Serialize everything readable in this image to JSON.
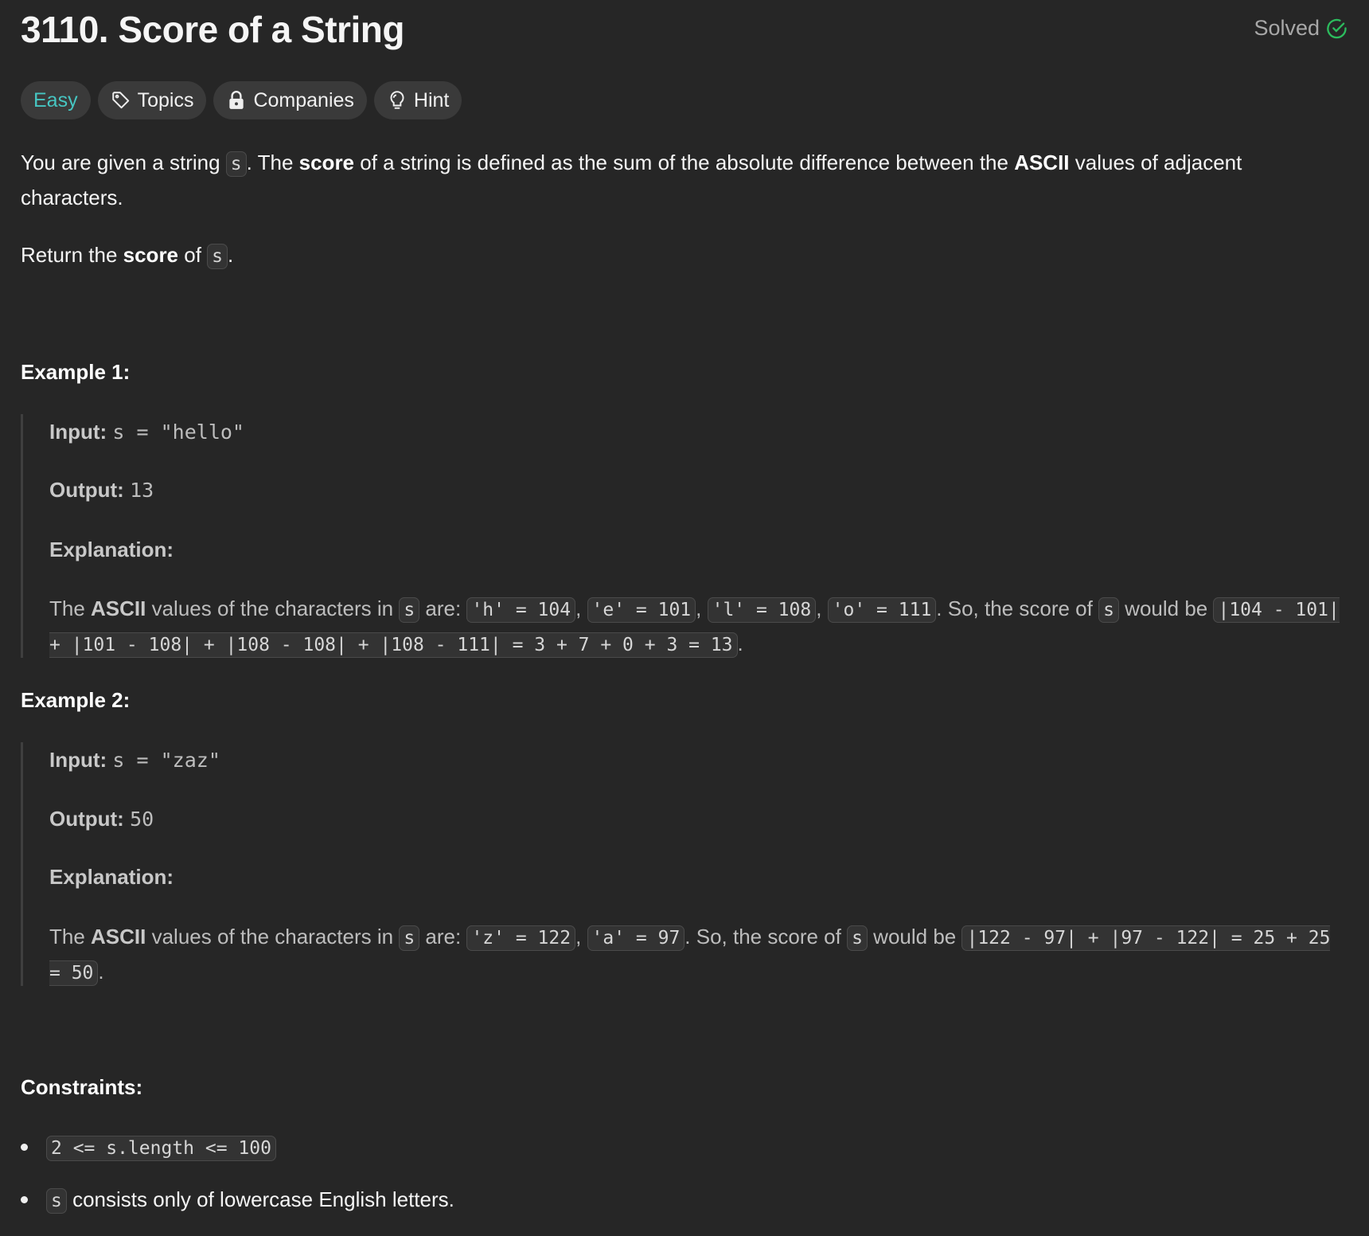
{
  "header": {
    "title": "3110. Score of a String",
    "status": "Solved",
    "status_color": "#2cbb5d"
  },
  "tags": {
    "difficulty": "Easy",
    "difficulty_color": "#46c6c2",
    "topics": "Topics",
    "companies": "Companies",
    "hint": "Hint"
  },
  "paragraphs": {
    "desc": [
      {
        "t": "You are given a string "
      },
      {
        "c": "s"
      },
      {
        "t": ". The "
      },
      {
        "b": "score"
      },
      {
        "t": " of a string is defined as the sum of the absolute difference between the "
      },
      {
        "b": "ASCII"
      },
      {
        "t": " values of adjacent characters."
      }
    ],
    "ret": [
      {
        "t": "Return the "
      },
      {
        "b": "score"
      },
      {
        "t": " of "
      },
      {
        "c": "s"
      },
      {
        "t": "."
      }
    ],
    "ex1_input": [
      {
        "b": "Input: "
      },
      {
        "m": "s = \"hello\""
      }
    ],
    "ex1_output": [
      {
        "b": "Output: "
      },
      {
        "m": "13"
      }
    ],
    "ex1_expl_label": [
      {
        "b": "Explanation:"
      }
    ],
    "ex1_expl": [
      {
        "t": "The "
      },
      {
        "b": "ASCII"
      },
      {
        "t": " values of the characters in "
      },
      {
        "c": "s"
      },
      {
        "t": " are: "
      },
      {
        "c": "'h' = 104"
      },
      {
        "t": ", "
      },
      {
        "c": "'e' = 101"
      },
      {
        "t": ", "
      },
      {
        "c": "'l' = 108"
      },
      {
        "t": ", "
      },
      {
        "c": "'o' = 111"
      },
      {
        "t": ". So, the score of "
      },
      {
        "c": "s"
      },
      {
        "t": " would be "
      },
      {
        "c": "|104 - 101| + |101 - 108| + |108 - 108| + |108 - 111| = 3 + 7 + 0 + 3 = 13"
      },
      {
        "t": "."
      }
    ],
    "ex2_input": [
      {
        "b": "Input: "
      },
      {
        "m": "s = \"zaz\""
      }
    ],
    "ex2_output": [
      {
        "b": "Output: "
      },
      {
        "m": "50"
      }
    ],
    "ex2_expl_label": [
      {
        "b": "Explanation:"
      }
    ],
    "ex2_expl": [
      {
        "t": "The "
      },
      {
        "b": "ASCII"
      },
      {
        "t": " values of the characters in "
      },
      {
        "c": "s"
      },
      {
        "t": " are: "
      },
      {
        "c": "'z' = 122"
      },
      {
        "t": ", "
      },
      {
        "c": "'a' = 97"
      },
      {
        "t": ". So, the score of "
      },
      {
        "c": "s"
      },
      {
        "t": " would be "
      },
      {
        "c": "|122 - 97| + |97 - 122| = 25 + 25 = 50"
      },
      {
        "t": "."
      }
    ],
    "c1": [
      {
        "c": "2 <= s.length <= 100"
      }
    ],
    "c2": [
      {
        "c": "s"
      },
      {
        "t": " consists only of lowercase English letters."
      }
    ]
  },
  "headings": {
    "example1": "Example 1:",
    "example2": "Example 2:",
    "constraints": "Constraints:"
  }
}
